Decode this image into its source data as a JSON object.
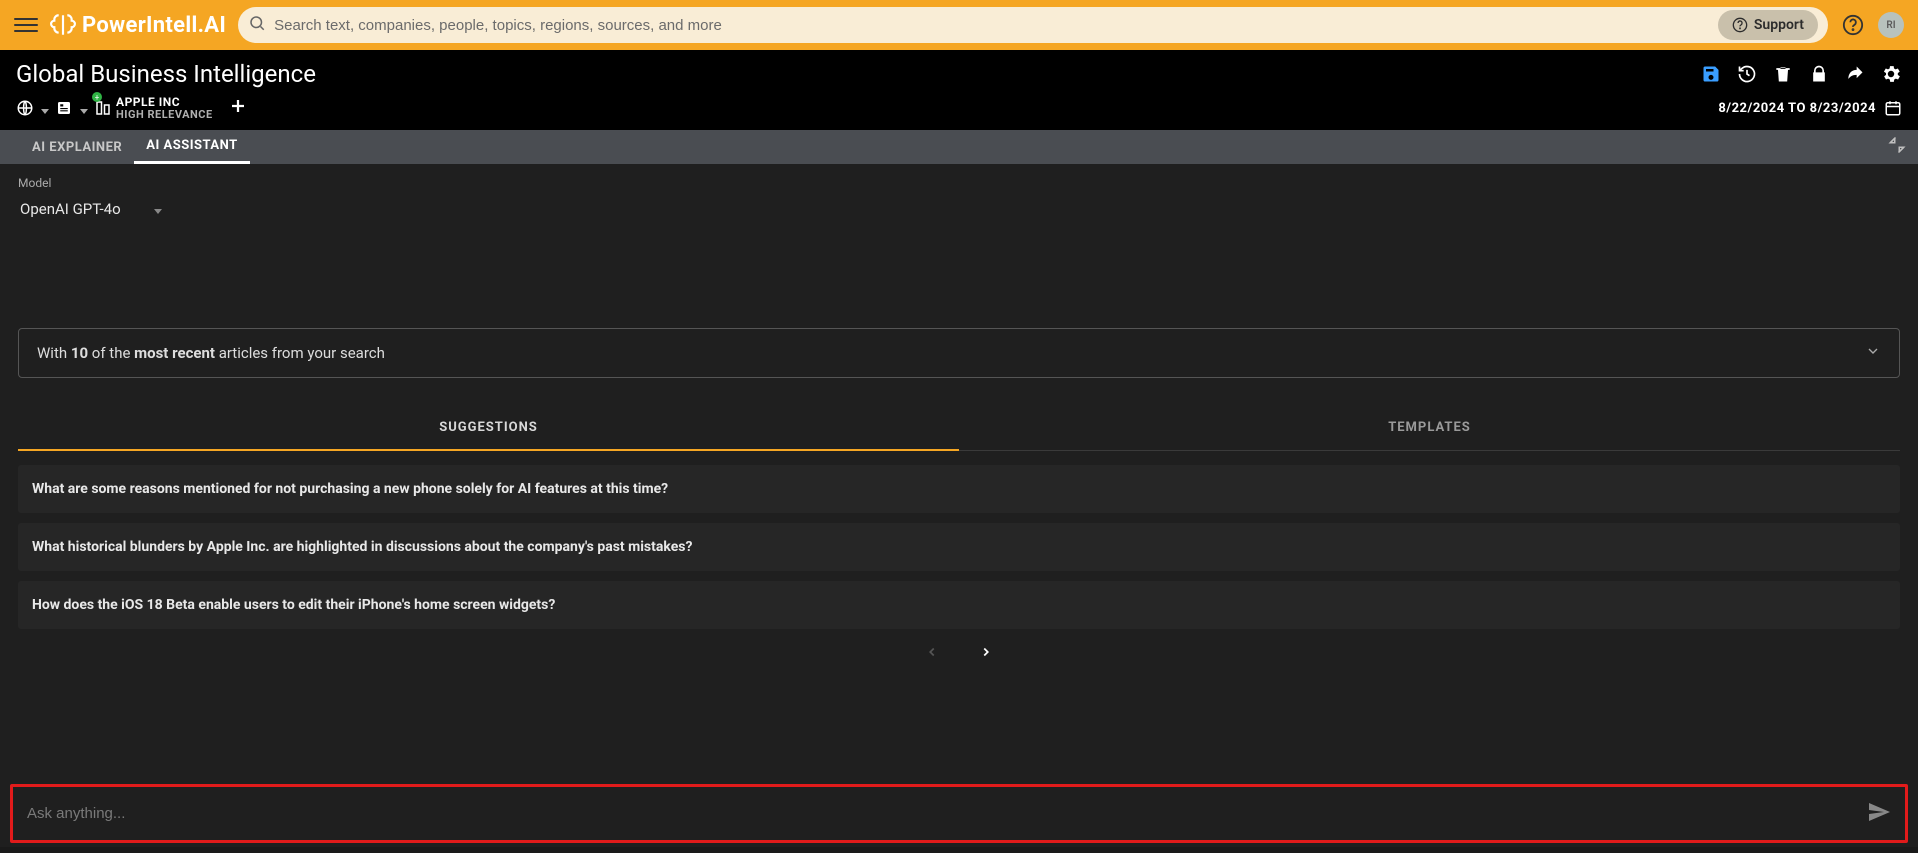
{
  "brand": "PowerIntell.AI",
  "search": {
    "placeholder": "Search text, companies, people, topics, regions, sources, and more"
  },
  "support_label": "Support",
  "avatar_initials": "RI",
  "page_title": "Global Business Intelligence",
  "date_range": "8/22/2024 TO 8/23/2024",
  "company": {
    "name": "APPLE INC",
    "relevance": "HIGH RELEVANCE"
  },
  "tabs": {
    "explainer": "AI EXPLAINER",
    "assistant": "AI ASSISTANT"
  },
  "model": {
    "label": "Model",
    "value": "OpenAI GPT-4o"
  },
  "context": {
    "prefix": "With ",
    "count": "10",
    "mid": " of the ",
    "emph": "most recent",
    "suffix": " articles from your search"
  },
  "subtabs": {
    "suggestions": "SUGGESTIONS",
    "templates": "TEMPLATES"
  },
  "suggestions": [
    "What are some reasons mentioned for not purchasing a new phone solely for AI features at this time?",
    "What historical blunders by Apple Inc. are highlighted in discussions about the company's past mistakes?",
    "How does the iOS 18 Beta enable users to edit their iPhone's home screen widgets?"
  ],
  "ask_placeholder": "Ask anything..."
}
